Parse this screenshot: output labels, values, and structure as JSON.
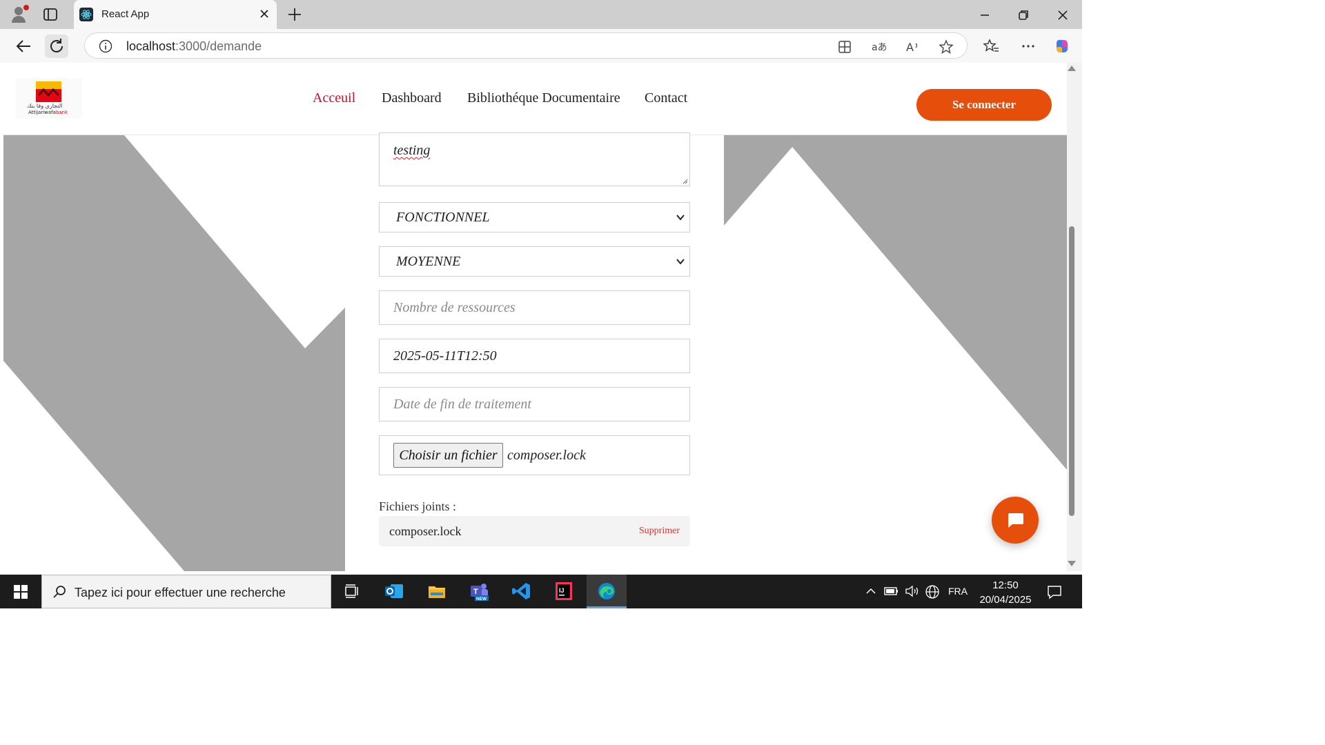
{
  "browser": {
    "tab_title": "React App",
    "url_host": "localhost",
    "url_path": ":3000/demande"
  },
  "site": {
    "logo": {
      "arabic_text": "التجاري وفا بنك",
      "brand": "Attijariwafa",
      "brand_suffix": "bank"
    },
    "nav": [
      {
        "label": "Acceuil",
        "active": true
      },
      {
        "label": "Dashboard",
        "active": false
      },
      {
        "label": "Bibliothéque Documentaire",
        "active": false
      },
      {
        "label": "Contact",
        "active": false
      }
    ],
    "connect_label": "Se connecter",
    "accent_color": "#e64e0b"
  },
  "form": {
    "description_value": "testing",
    "type_selected": "FONCTIONNEL",
    "priority_selected": "MOYENNE",
    "resources_placeholder": "Nombre de ressources",
    "start_date_value": "2025-05-11T12:50",
    "end_date_placeholder": "Date de fin de traitement",
    "file_button_label": "Choisir un fichier",
    "file_chosen": "composer.lock",
    "attached_label": "Fichiers joints :",
    "attachments": [
      {
        "name": "composer.lock",
        "remove_label": "Supprimer"
      }
    ]
  },
  "taskbar": {
    "search_placeholder": "Tapez ici pour effectuer une recherche",
    "language": "FRA",
    "time": "12:50",
    "date": "20/04/2025"
  }
}
